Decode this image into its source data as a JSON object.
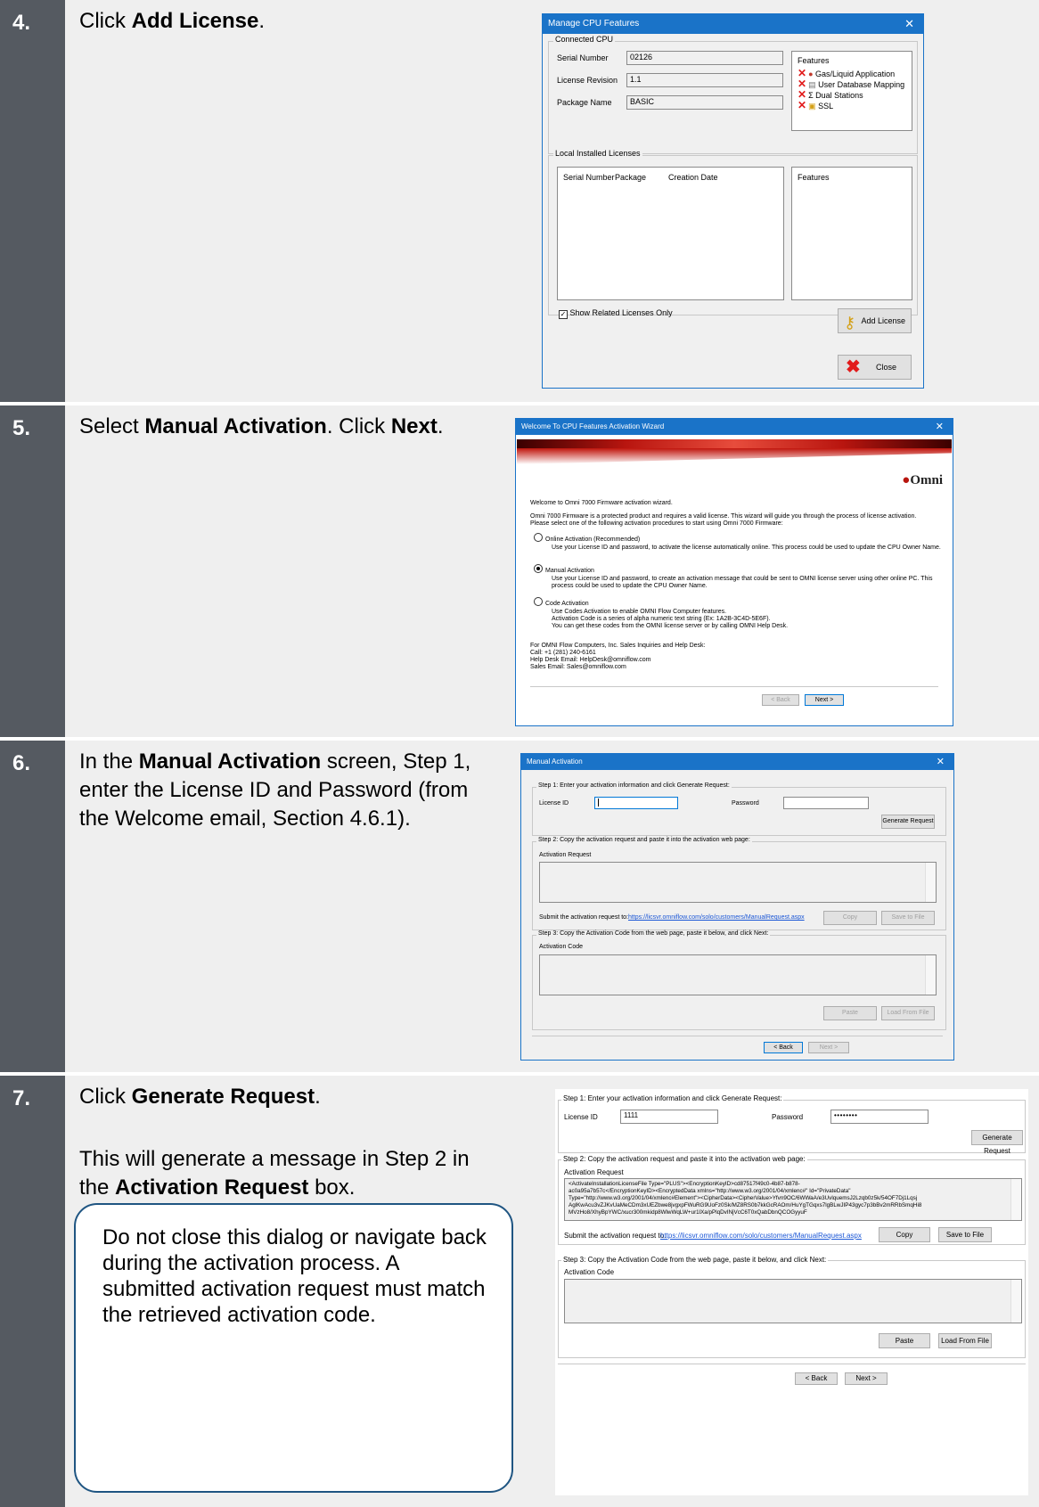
{
  "rows": [
    {
      "number": "4.",
      "instruction": {
        "pre": "Click ",
        "bold": "Add License",
        "post": "."
      }
    },
    {
      "number": "5.",
      "instruction": {
        "pre": "Select ",
        "bold": "Manual Activation",
        "mid": ". Click ",
        "bold2": "Next",
        "post": "."
      }
    },
    {
      "number": "6.",
      "instruction": {
        "pre": "In the ",
        "bold": "Manual Activation",
        "post": " screen, Step 1, enter the License ID and Password (from the Welcome email, Section 4.6.1)."
      }
    },
    {
      "number": "7.",
      "instruction": {
        "pre": "Click ",
        "bold": "Generate Request",
        "post": "."
      },
      "detail": {
        "pre": "This will generate a message in Step 2 in the ",
        "bold": "Activation Request",
        "post": " box."
      },
      "note": "Do not close this dialog or navigate back during the activation process. A submitted activation request must match the retrieved activation code."
    }
  ],
  "cpu_dialog": {
    "title": "Manage CPU Features",
    "connected_label": "Connected CPU",
    "serial_label": "Serial Number",
    "serial_value": "02126",
    "revision_label": "License Revision",
    "revision_value": "1.1",
    "package_label": "Package Name",
    "package_value": "BASIC",
    "features_label": "Features",
    "features": [
      "Gas/Liquid Application",
      "User Database Mapping",
      "Dual Stations",
      "SSL"
    ],
    "local_label": "Local Installed Licenses",
    "col_serial": "Serial Number",
    "col_package": "Package",
    "col_date": "Creation Date",
    "features_col": "Features",
    "show_related": "Show Related Licenses Only",
    "add_license": "Add License",
    "close": "Close"
  },
  "wizard": {
    "title": "Welcome To CPU Features Activation Wizard",
    "logo": "Omni",
    "welcome": "Welcome to Omni 7000 Firmware activation wizard.",
    "intro1": "Omni 7000 Firmware is a protected product and requires a valid license. This wizard will guide you through the process of license activation.",
    "intro2": "Please select one of the following activation procedures to start using Omni 7000 Firmware:",
    "opt_online": "Online Activation (Recommended)",
    "opt_online_desc": "Use your License ID and password, to activate the license automatically online. This process could be used to update the CPU Owner  Name.",
    "opt_manual": "Manual Activation",
    "opt_manual_desc1": "Use your License ID and password, to create an activation message that could be sent to OMNI license server using other online PC.  This",
    "opt_manual_desc2": "process could be used to update the CPU Owner  Name.",
    "opt_code": "Code Activation",
    "opt_code_desc1": "Use Codes Activation to enable OMNI Flow Computer features.",
    "opt_code_desc2": "Activation Code is a series of alpha numeric text string (Ex: 1A2B-3C4D-5E6F).",
    "opt_code_desc3": "You can get these codes from the OMNI license server or by calling OMNI Help Desk.",
    "contact1": "For OMNI Flow Computers, Inc. Sales Inquiries and Help Desk:",
    "contact2": "Call: +1 (281) 240-6161",
    "contact3": "Help Desk Email: HelpDesk@omniflow.com",
    "contact4": "Sales Email: Sales@omniflow.com",
    "back": "< Back",
    "next": "Next >"
  },
  "manual": {
    "title": "Manual Activation",
    "step1": "Step 1: Enter your activation information and click Generate Request:",
    "license_id": "License ID",
    "password": "Password",
    "generate": "Generate Request",
    "step2": "Step 2: Copy the activation request and paste it into the activation web page:",
    "activation_request": "Activation Request",
    "submit_to": "Submit the activation request to:",
    "url": "https://licsvr.omniflow.com/solo/customers/ManualRequest.aspx",
    "copy": "Copy",
    "save": "Save to File",
    "step3": "Step 3: Copy the Activation Code from the web page, paste it below, and click Next:",
    "activation_code": "Activation Code",
    "paste": "Paste",
    "load": "Load From File",
    "back": "< Back",
    "next": "Next >"
  },
  "manual_filled": {
    "license_value": "1111",
    "password_mask": "••••••••",
    "request_lines": [
      "<ActivateInstallationLicenseFile Type=\"PLUS\"><EncryptionKeyID>cd87517f49c0-4b87-b878-",
      "ac0a95a7b57c</EncryptionKeyID><EncryptedData xmlns=\"http://www.w3.org/2001/04/xmlenc#\" Id=\"PrivateData\"",
      "Type=\"http://www.w3.org/2001/04/xmlenc#Element\"><CipherData><CipherValue>Yfvn9OC/6WWaA/e3UvlquemsJ2Lzqb0z5k/54OF7Dj1Lqsj",
      "AglKwAcu3vZJKvUaMeCDm3xUEZbwe8jvgxpFWuRG9UoFz0Sk/MZ8RS0b7kkGcRAOm/HuYgTGqxs7lgBLwJIP43gyc7p3bBv2mRRbSmqHi8",
      "MVzHo8/XhyBpYWC/xucr300mkidp8WlwWqLW+ur1lXa/pPlqDvINjVcC6T0xQabDbnQCOGyyuF"
    ]
  }
}
